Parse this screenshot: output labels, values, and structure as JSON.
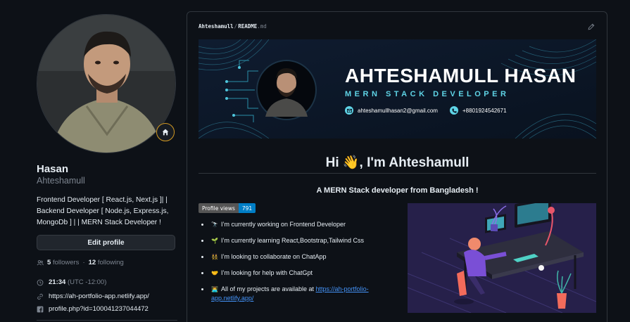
{
  "profile": {
    "name": "Hasan",
    "login": "Ahteshamull",
    "bio": "Frontend Developer [ React.js, Next.js ]| | Backend Developer [ Node.js, Express.js, MongoDb ] | | MERN Stack Developer !",
    "edit_label": "Edit profile",
    "followers_count": "5",
    "followers_label": "followers",
    "following_sep": "·",
    "following_count": "12",
    "following_label": "following",
    "local_time": "21:34",
    "timezone": "(UTC -12:00)",
    "website": "https://ah-portfolio-app.netlify.app/",
    "facebook": "profile.php?id=100041237044472"
  },
  "readme": {
    "owner": "Ahteshamull",
    "path_sep": "/",
    "file": "README",
    "ext": ".md",
    "banner": {
      "name": "AHTESHAMULL HASAN",
      "role": "MERN STACK DEVELOPER",
      "email": "ahteshamullhasan2@gmail.com",
      "phone": "+8801924542671"
    },
    "heading": "Hi 👋, I'm Ahteshamull",
    "subheading": "A MERN Stack developer from Bangladesh !",
    "profile_views_label": "Profile views",
    "profile_views_value": "791",
    "items": [
      {
        "emoji": "🔭",
        "text": "I’m currently working on Frontend Developer"
      },
      {
        "emoji": "🌱",
        "text": "I’m currently learning React,Bootstrap,Tailwind Css"
      },
      {
        "emoji": "👯",
        "text": "I’m looking to collaborate on ChatApp"
      },
      {
        "emoji": "🤝",
        "text": "I’m looking for help with ChatGpt"
      },
      {
        "emoji": "👨‍💻",
        "text": "All of my projects are available at ",
        "link": "https://ah-portfolio-app.netlify.app/"
      }
    ]
  },
  "colors": {
    "background": "#0d1117",
    "border": "#30363d",
    "muted": "#7d8590",
    "link": "#4493f8",
    "status_ring": "#d29922",
    "banner_accent": "#5fd4e6"
  },
  "icons": [
    "home-icon",
    "people-icon",
    "clock-icon",
    "link-icon",
    "facebook-icon",
    "pencil-icon",
    "mail-icon",
    "phone-icon"
  ]
}
